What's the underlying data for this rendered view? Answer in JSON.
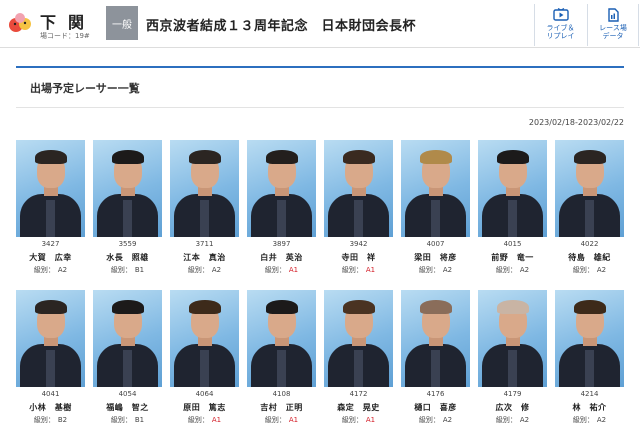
{
  "header": {
    "venue_name": "下関",
    "venue_code": "場コード：19#",
    "grade": "一般",
    "race_title": "西京波者結成１３周年記念　日本財団会長杯",
    "buttons": [
      {
        "label": "ライブ＆\nリプレイ",
        "icon": "tv-icon"
      },
      {
        "label": "レース場\nデータ",
        "icon": "document-icon"
      }
    ]
  },
  "panel": {
    "title": "出場予定レーサー一覧",
    "date_range": "2023/02/18-2023/02/22"
  },
  "class_label": "級別：",
  "colors": {
    "accent": "#2c6fbf",
    "a1": "#d4202a",
    "badge": "#8d939b"
  },
  "racers": [
    {
      "reg": "3427",
      "name": "大賀　広幸",
      "cls": "A2"
    },
    {
      "reg": "3559",
      "name": "水長　照雄",
      "cls": "B1"
    },
    {
      "reg": "3711",
      "name": "江本　真治",
      "cls": "A2"
    },
    {
      "reg": "3897",
      "name": "白井　英治",
      "cls": "A1"
    },
    {
      "reg": "3942",
      "name": "寺田　祥",
      "cls": "A1"
    },
    {
      "reg": "4007",
      "name": "梁田　将彦",
      "cls": "A2"
    },
    {
      "reg": "4015",
      "name": "前野　竜一",
      "cls": "A2"
    },
    {
      "reg": "4022",
      "name": "待島　雄紀",
      "cls": "A2"
    },
    {
      "reg": "4041",
      "name": "小林　基樹",
      "cls": "B2"
    },
    {
      "reg": "4054",
      "name": "福嶋　智之",
      "cls": "B1"
    },
    {
      "reg": "4064",
      "name": "原田　篤志",
      "cls": "A1"
    },
    {
      "reg": "4108",
      "name": "吉村　正明",
      "cls": "A1"
    },
    {
      "reg": "4172",
      "name": "森定　晃史",
      "cls": "A1"
    },
    {
      "reg": "4176",
      "name": "樋口　喜彦",
      "cls": "A2"
    },
    {
      "reg": "4179",
      "name": "広次　修",
      "cls": "A2"
    },
    {
      "reg": "4214",
      "name": "林　祐介",
      "cls": "A2"
    }
  ]
}
